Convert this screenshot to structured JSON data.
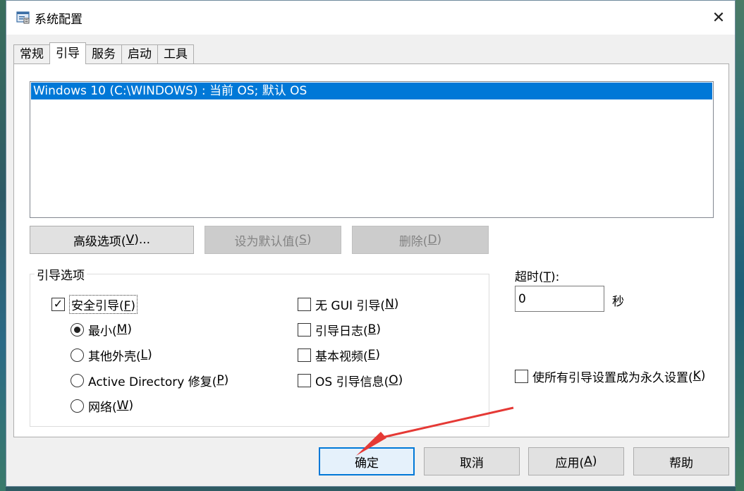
{
  "window": {
    "title": "系统配置",
    "close_glyph": "✕",
    "icon": "msconfig-icon"
  },
  "tabs": [
    {
      "label": "常规",
      "active": false
    },
    {
      "label": "引导",
      "active": true
    },
    {
      "label": "服务",
      "active": false
    },
    {
      "label": "启动",
      "active": false
    },
    {
      "label": "工具",
      "active": false
    }
  ],
  "boot": {
    "os_entries": [
      "Windows 10 (C:\\WINDOWS) : 当前 OS; 默认 OS"
    ],
    "buttons": {
      "advanced": {
        "text": "高级选项(",
        "key": "V",
        "suffix": ")..."
      },
      "set_default": {
        "text": "设为默认值(",
        "key": "S",
        "suffix": ")"
      },
      "delete": {
        "text": "删除(",
        "key": "D",
        "suffix": ")"
      }
    },
    "options_group_label": "引导选项",
    "safe_boot": {
      "text": "安全引导(",
      "key": "F",
      "suffix": ")",
      "checked": true
    },
    "radios": {
      "minimal": {
        "text": "最小(",
        "key": "M",
        "suffix": ")",
        "selected": true
      },
      "alternate_shell": {
        "text": "其他外壳(",
        "key": "L",
        "suffix": ")",
        "selected": false
      },
      "ad_repair": {
        "text": "Active Directory 修复(",
        "key": "P",
        "suffix": ")",
        "selected": false
      },
      "network": {
        "text": "网络(",
        "key": "W",
        "suffix": ")",
        "selected": false
      }
    },
    "checks": {
      "no_gui": {
        "text": "无 GUI 引导(",
        "key": "N",
        "suffix": ")",
        "checked": false
      },
      "boot_log": {
        "text": "引导日志(",
        "key": "B",
        "suffix": ")",
        "checked": false
      },
      "base_video": {
        "text": "基本视频(",
        "key": "E",
        "suffix": ")",
        "checked": false
      },
      "os_boot_info": {
        "text": "OS 引导信息(",
        "key": "O",
        "suffix": ")",
        "checked": false
      }
    },
    "timeout": {
      "text": "超时(",
      "key": "T",
      "suffix": "):",
      "value": "0",
      "unit": "秒"
    },
    "permanent": {
      "text": "使所有引导设置成为永久设置(",
      "key": "K",
      "suffix": ")",
      "checked": false
    }
  },
  "footer": {
    "ok": "确定",
    "cancel": "取消",
    "apply": {
      "text": "应用(",
      "key": "A",
      "suffix": ")"
    },
    "help": "帮助"
  },
  "annotation": {
    "color": "#e53935"
  },
  "colors": {
    "selection": "#0078d7",
    "primary_border": "#0078d7"
  }
}
